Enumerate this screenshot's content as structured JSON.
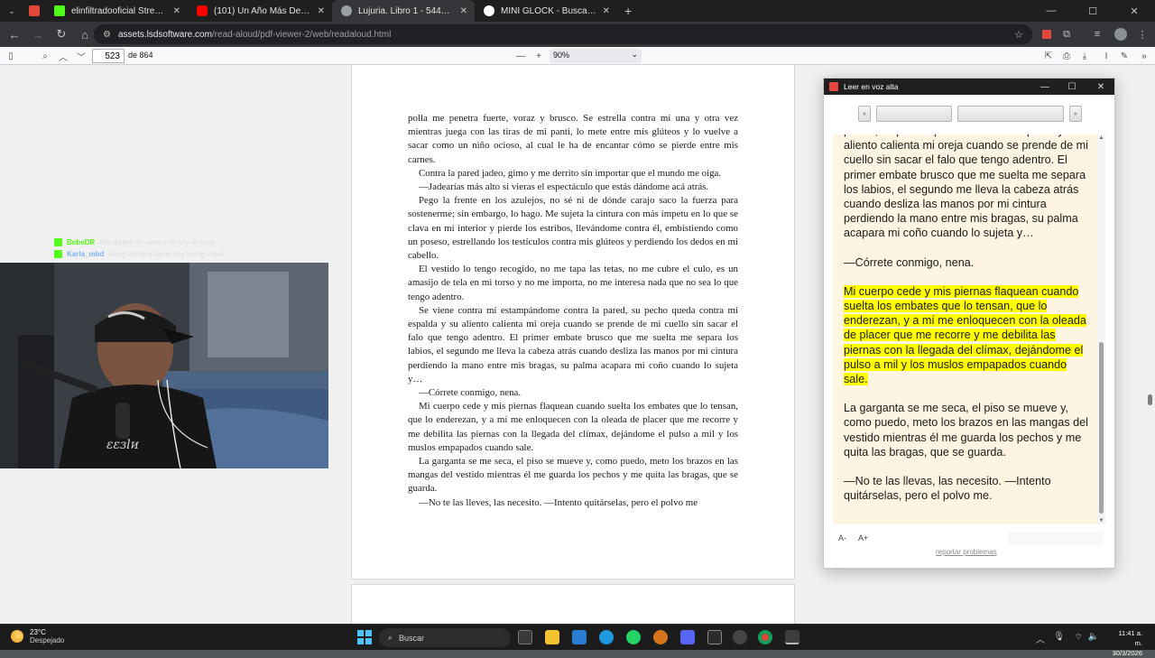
{
  "browser": {
    "tabs": [
      {
        "title": "elinfiltradooficial Stream - Watc",
        "favicon_color": "#53fc18",
        "active": false
      },
      {
        "title": "(101) Un Año Más De Tu Vida -",
        "favicon_color": "#ff0000",
        "active": false
      },
      {
        "title": "Lujuria. Libro 1 - 544a0087-069",
        "favicon_color": "#9aa0a6",
        "active": true
      },
      {
        "title": "MINI GLOCK - Buscar con Goog",
        "favicon_color": "#ffffff",
        "active": false
      }
    ],
    "new_tab_label": "+",
    "close_tab_label": "✕",
    "url_host": "assets.lsdsoftware.com",
    "url_path": "/read-aloud/pdf-viewer-2/web/readaloud.html"
  },
  "pdf_toolbar": {
    "page_number": "523",
    "page_total": "de 864",
    "zoom": "90%"
  },
  "pdf_page": {
    "paragraphs": [
      "polla me penetra fuerte, voraz y brusco. Se estrella contra mí una y otra vez mientras juega con las tiras de mi panti, lo mete entre mis glúteos y lo vuelve a sacar como un niño ocioso, al cual le ha de encantar cómo se pierde entre mis carnes.",
      "Contra la pared jadeo, gimo y me derrito sin importar que el mundo me oiga.",
      "—Jadearías más alto si vieras el espectáculo que estás dándome acá atrás.",
      "Pego la frente en los azulejos, no sé ni de dónde carajo saco la fuerza para sostenerme; sin embargo, lo hago. Me sujeta la cintura con más ímpetu en lo que se clava en mi interior y pierde los estribos, llevándome contra él, embistiendo como un poseso, estrellando los testículos contra mis glúteos y perdiendo los dedos en mi cabello.",
      "El vestido lo tengo recogido, no me tapa las tetas, no me cubre el culo, es un amasijo de tela en mi torso y no me importa, no me interesa nada que no sea lo que tengo adentro.",
      "Se viene contra mí estampándome contra la pared, su pecho queda contra mi espalda y su aliento calienta mi oreja cuando se prende de mi cuello sin sacar el falo que tengo adentro. El primer embate brusco que me suelta me separa los labios, el segundo me lleva la cabeza atrás cuando desliza las manos por mi cintura perdiendo la mano entre mis bragas, su palma acapara mi coño cuando lo sujeta y…",
      "—Córrete conmigo, nena.",
      "Mi cuerpo cede y mis piernas flaquean cuando suelta los embates que lo tensan, que lo enderezan, y a mí me enloquecen con la oleada de placer que me recorre y me debilita las piernas con la llegada del clímax, dejándome el pulso a mil y los muslos empapados cuando sale.",
      "La garganta se me seca, el piso se mueve y, como puedo, meto los brazos en las mangas del vestido mientras él me guarda los pechos y me quita las bragas, que se guarda.",
      "—No te las lleves, las necesito. —Intento quitárselas, pero el polvo me"
    ]
  },
  "stream": {
    "chat": [
      {
        "user": "BebeDR",
        "user_color": "#53fc18",
        "message": "ella quiere un nene y yo soy el nene"
      },
      {
        "user": "Karla_mbd",
        "user_color": "#7fb2ff",
        "message": "boing como el bano soy boing sopel"
      }
    ]
  },
  "read_aloud": {
    "title": "Leer en voz alta",
    "prev_label": "«",
    "next_label": "»",
    "paragraphs": [
      {
        "text": "pecho, su pecho queda contra mi espalda y su aliento calienta mi oreja cuando se prende de mi cuello sin sacar el falo que tengo adentro. El primer embate brusco que me suelta me separa los labios, el segundo me lleva la cabeza atrás cuando desliza las manos por mi cintura perdiendo la mano entre mis bragas, su palma acapara mi coño cuando lo sujeta y…",
        "highlight": false
      },
      {
        "text": "—Córrete conmigo, nena.",
        "highlight": false
      },
      {
        "text": "Mi cuerpo cede y mis piernas flaquean cuando suelta los embates que lo tensan, que lo enderezan, y a mí me enloquecen con la oleada de placer que me recorre y me debilita las piernas con la llegada del clímax, dejándome el pulso a mil y los muslos empapados cuando sale.",
        "highlight": true
      },
      {
        "text": "La garganta se me seca, el piso se mueve y, como puedo, meto los brazos en las mangas del vestido mientras él me guarda los pechos y me quita las bragas, que se guarda.",
        "highlight": false
      },
      {
        "text": "—No te las llevas, las necesito. —Intento quitárselas, pero el polvo me.",
        "highlight": false
      }
    ],
    "font_smaller": "A-",
    "font_larger": "A+",
    "report_link": "reportar problemas",
    "highlight_color": "#ffff00",
    "background_color": "#fdf4e1"
  },
  "taskbar": {
    "temperature": "23°C",
    "condition": "Despejado",
    "search_placeholder": "Buscar",
    "time": "11:41 a. m.",
    "date": "30/3/2026"
  }
}
